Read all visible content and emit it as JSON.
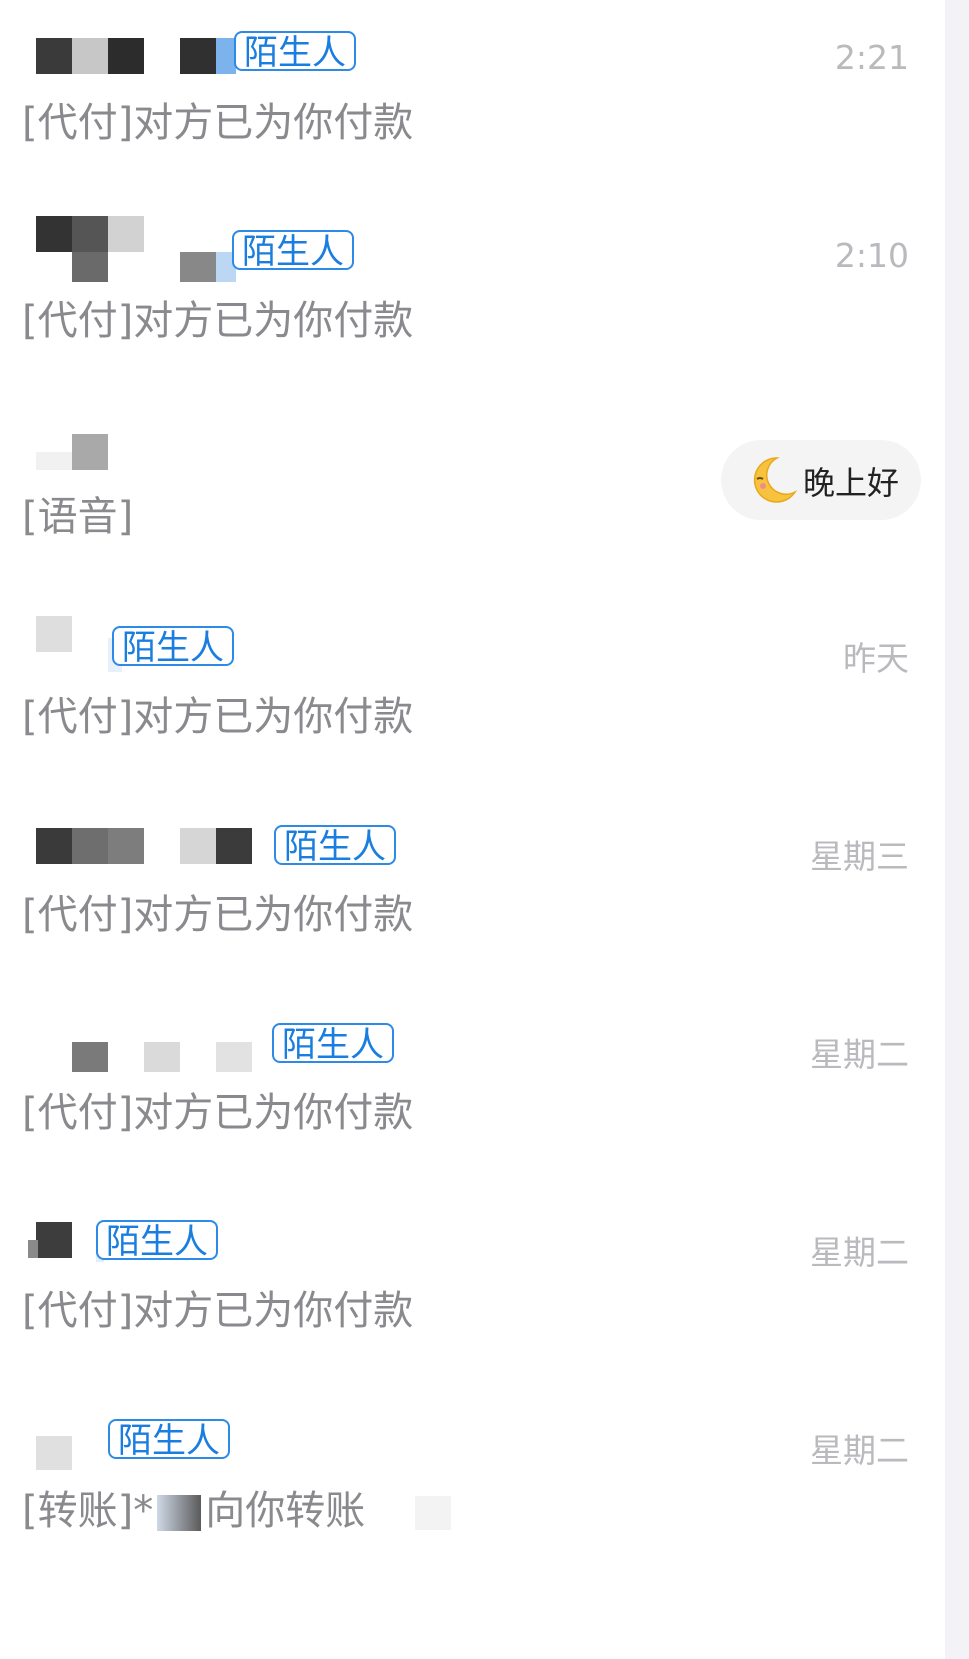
{
  "chats": [
    {
      "tag": "陌生人",
      "time": "2:21",
      "message": "[代付]对方已为你付款"
    },
    {
      "tag": "陌生人",
      "time": "2:10",
      "message": "[代付]对方已为你付款"
    },
    {
      "tag": "",
      "time": "",
      "message": "[语音]",
      "greeting": "晚上好",
      "greeting_icon": "moon-icon"
    },
    {
      "tag": "陌生人",
      "time": "昨天",
      "message": "[代付]对方已为你付款"
    },
    {
      "tag": "陌生人",
      "time": "星期三",
      "message": "[代付]对方已为你付款"
    },
    {
      "tag": "陌生人",
      "time": "星期二",
      "message": "[代付]对方已为你付款"
    },
    {
      "tag": "陌生人",
      "time": "星期二",
      "message": "[代付]对方已为你付款"
    },
    {
      "tag": "陌生人",
      "time": "星期二",
      "message": "[转账]*",
      "message_tail": "向你转账"
    }
  ],
  "colors": {
    "tag_border": "#2d8ae6",
    "tag_text": "#1a7de0",
    "time_text": "#b9b9be",
    "message_text": "#8a8a8e"
  }
}
